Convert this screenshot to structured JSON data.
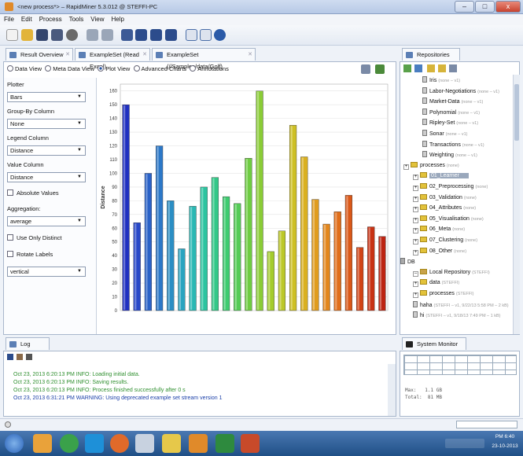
{
  "window": {
    "title": "<new process*> – RapidMiner 5.3.012 @ STEFFI-PC",
    "controls": {
      "minimize": "–",
      "maximize": "□",
      "close": "x"
    }
  },
  "menu": [
    "File",
    "Edit",
    "Process",
    "Tools",
    "View",
    "Help"
  ],
  "tabs": {
    "main": [
      {
        "label": "Result Overview"
      },
      {
        "label": "ExampleSet (Read Excel)"
      },
      {
        "label": "ExampleSet (//Samples/data/Golf)"
      }
    ],
    "repositories": "Repositories",
    "log": "Log",
    "system_monitor": "System Monitor"
  },
  "view_modes": [
    "Data View",
    "Meta Data View",
    "Plot View",
    "Advanced Charts",
    "Annotations"
  ],
  "selected_view": "Plot View",
  "plot_settings": {
    "plotter_label": "Plotter",
    "plotter_value": "Bars",
    "group_by_label": "Group-By Column",
    "group_by_value": "None",
    "legend_label": "Legend Column",
    "legend_value": "Distance",
    "value_label": "Value Column",
    "value_value": "Distance",
    "absolute_values": "Absolute Values",
    "aggregation_label": "Aggregation:",
    "aggregation_value": "average",
    "use_only_distinct": "Use Only Distinct",
    "rotate_labels": "Rotate Labels",
    "orientation_value": "vertical"
  },
  "chart_data": {
    "type": "bar",
    "ylabel": "Distance",
    "ylim": [
      0,
      165
    ],
    "yticks": [
      0,
      10,
      20,
      30,
      40,
      50,
      60,
      70,
      80,
      90,
      100,
      110,
      120,
      130,
      140,
      150,
      160
    ],
    "values": [
      150,
      64,
      100,
      120,
      80,
      45,
      76,
      90,
      97,
      83,
      78,
      111,
      160,
      43,
      58,
      135,
      112,
      81,
      63,
      72,
      84,
      46,
      61,
      54
    ],
    "colors": [
      "#2030c0",
      "#2848c8",
      "#2a62c8",
      "#2c78c8",
      "#2b8ec4",
      "#2aa4c0",
      "#2ab8b4",
      "#2cc4a0",
      "#32c888",
      "#3ecc70",
      "#54cc56",
      "#6ecc42",
      "#8acc36",
      "#a4cc2c",
      "#bcc828",
      "#cec024",
      "#dab020",
      "#e09c1e",
      "#e2861c",
      "#e06e1a",
      "#da5818",
      "#d24416",
      "#c83214",
      "#bc2412"
    ]
  },
  "repository_tree": [
    {
      "label": "Iris",
      "sub": "(none – v1)",
      "kind": "doc"
    },
    {
      "label": "Labor-Negotiations",
      "sub": "(none – v1)",
      "kind": "doc"
    },
    {
      "label": "Market-Data",
      "sub": "(none – v1)",
      "kind": "doc"
    },
    {
      "label": "Polynomial",
      "sub": "(none – v1)",
      "kind": "doc"
    },
    {
      "label": "Ripley-Set",
      "sub": "(none – v1)",
      "kind": "doc"
    },
    {
      "label": "Sonar",
      "sub": "(none – v1)",
      "kind": "doc"
    },
    {
      "label": "Transactions",
      "sub": "(none – v1)",
      "kind": "doc"
    },
    {
      "label": "Weighting",
      "sub": "(none – v1)",
      "kind": "doc"
    },
    {
      "label": "processes",
      "sub": "(none)",
      "kind": "folder"
    },
    {
      "label": "01_Learner",
      "sub": "",
      "kind": "folder-selected"
    },
    {
      "label": "02_Preprocessing",
      "sub": "(none)",
      "kind": "folder"
    },
    {
      "label": "03_Validation",
      "sub": "(none)",
      "kind": "folder"
    },
    {
      "label": "04_Attributes",
      "sub": "(none)",
      "kind": "folder"
    },
    {
      "label": "05_Visualisation",
      "sub": "(none)",
      "kind": "folder"
    },
    {
      "label": "06_Meta",
      "sub": "(none)",
      "kind": "folder"
    },
    {
      "label": "07_Clustering",
      "sub": "(none)",
      "kind": "folder"
    },
    {
      "label": "08_Other",
      "sub": "(none)",
      "kind": "folder"
    },
    {
      "label": "DB",
      "sub": "",
      "kind": "db"
    },
    {
      "label": "Local Repository",
      "sub": "(STEFFI)",
      "kind": "repo"
    },
    {
      "label": "data",
      "sub": "(STEFFI)",
      "kind": "folder"
    },
    {
      "label": "processes",
      "sub": "(STEFFI)",
      "kind": "folder"
    },
    {
      "label": "haha",
      "sub": "(STEFFI – v1, 9/22/13 5:58 PM – 2 kB)",
      "kind": "doc"
    },
    {
      "label": "hi",
      "sub": "(STEFFI – v1, 9/18/13 7:49 PM – 1 kB)",
      "kind": "doc"
    }
  ],
  "log_lines": [
    "Oct 23, 2013 6:20:13 PM INFO: Loading initial data.",
    "Oct 23, 2013 6:20:13 PM INFO: Saving results.",
    "Oct 23, 2013 6:20:13 PM INFO: Process finished successfully after 0 s",
    "Oct 23, 2013 6:31:21 PM WARNING: Using deprecated example set stream version 1"
  ],
  "system_monitor": {
    "max": "Max:   1.1 GB",
    "total": "Total:  81 MB"
  },
  "clock": {
    "time": "PM 6:40",
    "date": "23-10-2013"
  }
}
